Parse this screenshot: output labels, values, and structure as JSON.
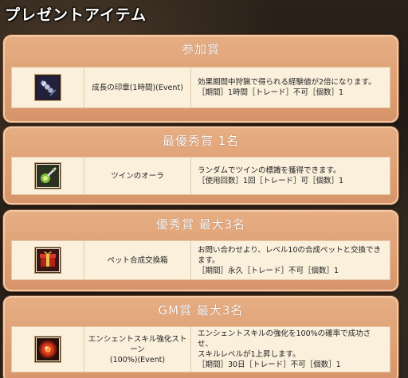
{
  "page": {
    "title": "プレゼントアイテム"
  },
  "sections": [
    {
      "header": "参加賞",
      "item": {
        "icon": "sword-scroll-icon",
        "name_lines": [
          "成長の印章(1時間)(Event)"
        ],
        "desc_lines": [
          "効果期間中狩猟で得られる経験値が2倍になります。",
          "［期間］1時間［トレード］不可［個数］1"
        ]
      }
    },
    {
      "header": "最優秀賞 1名",
      "item": {
        "icon": "twin-aura-icon",
        "name_lines": [
          "ツインのオーラ"
        ],
        "desc_lines": [
          "ランダムでツインの標識を獲得できます。",
          "［使用回数］1回［トレード］可［個数］1"
        ]
      }
    },
    {
      "header": "優秀賞 最大3名",
      "item": {
        "icon": "pet-box-icon",
        "name_lines": [
          "ペット合成交換箱"
        ],
        "desc_lines": [
          "お問い合わせより、レベル10の合成ペットと交換できます。",
          "［期間］永久［トレード］不可［個数］1"
        ]
      }
    },
    {
      "header": "GM賞 最大3名",
      "item": {
        "icon": "ancient-stone-icon",
        "name_lines": [
          "エンシェントスキル強化ストーン",
          "(100%)(Event)"
        ],
        "desc_lines": [
          "エンシェントスキルの強化を100%の確率で成功させ、",
          "スキルレベルが1上昇します。",
          "［期間］30日［トレード］不可［個数］1"
        ]
      }
    }
  ]
}
